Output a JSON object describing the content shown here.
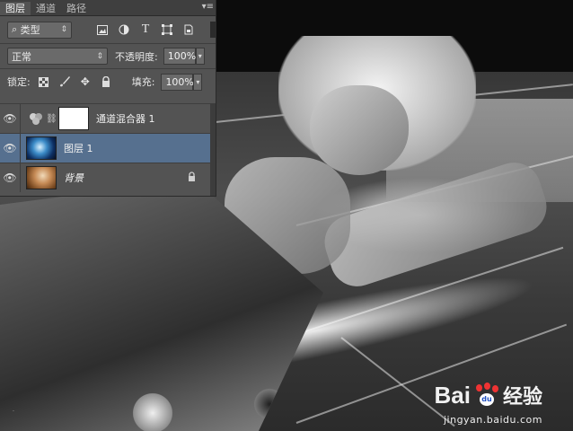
{
  "panel": {
    "tabs": [
      {
        "label": "图层",
        "active": true
      },
      {
        "label": "通道",
        "active": false
      },
      {
        "label": "路径",
        "active": false
      }
    ],
    "menu_icon": "panel-menu-icon",
    "filter": {
      "label": "类型",
      "icon": "search-icon"
    },
    "filter_icons": [
      "image-filter-icon",
      "adjustment-filter-icon",
      "type-filter-icon",
      "shape-filter-icon",
      "smart-object-filter-icon"
    ],
    "blend_mode": "正常",
    "opacity_label": "不透明度:",
    "opacity_value": "100%",
    "lock_label": "锁定:",
    "lock_icons": [
      "lock-transparent-icon",
      "lock-paint-icon",
      "lock-move-icon",
      "lock-all-icon"
    ],
    "fill_label": "填充:",
    "fill_value": "100%",
    "layers": [
      {
        "name": "通道混合器 1",
        "type": "adjustment",
        "visible": true,
        "selected": false
      },
      {
        "name": "图层 1",
        "type": "pixel",
        "visible": true,
        "selected": true
      },
      {
        "name": "背景",
        "type": "background",
        "visible": true,
        "selected": false,
        "locked": true
      }
    ]
  },
  "watermark": {
    "brand": "Bai",
    "paw": "du",
    "cn": "经验",
    "url": "jingyan.baidu.com"
  },
  "colors": {
    "panel_bg": "#535353",
    "selected_layer": "#56708f",
    "baidu_red": "#e33333"
  }
}
